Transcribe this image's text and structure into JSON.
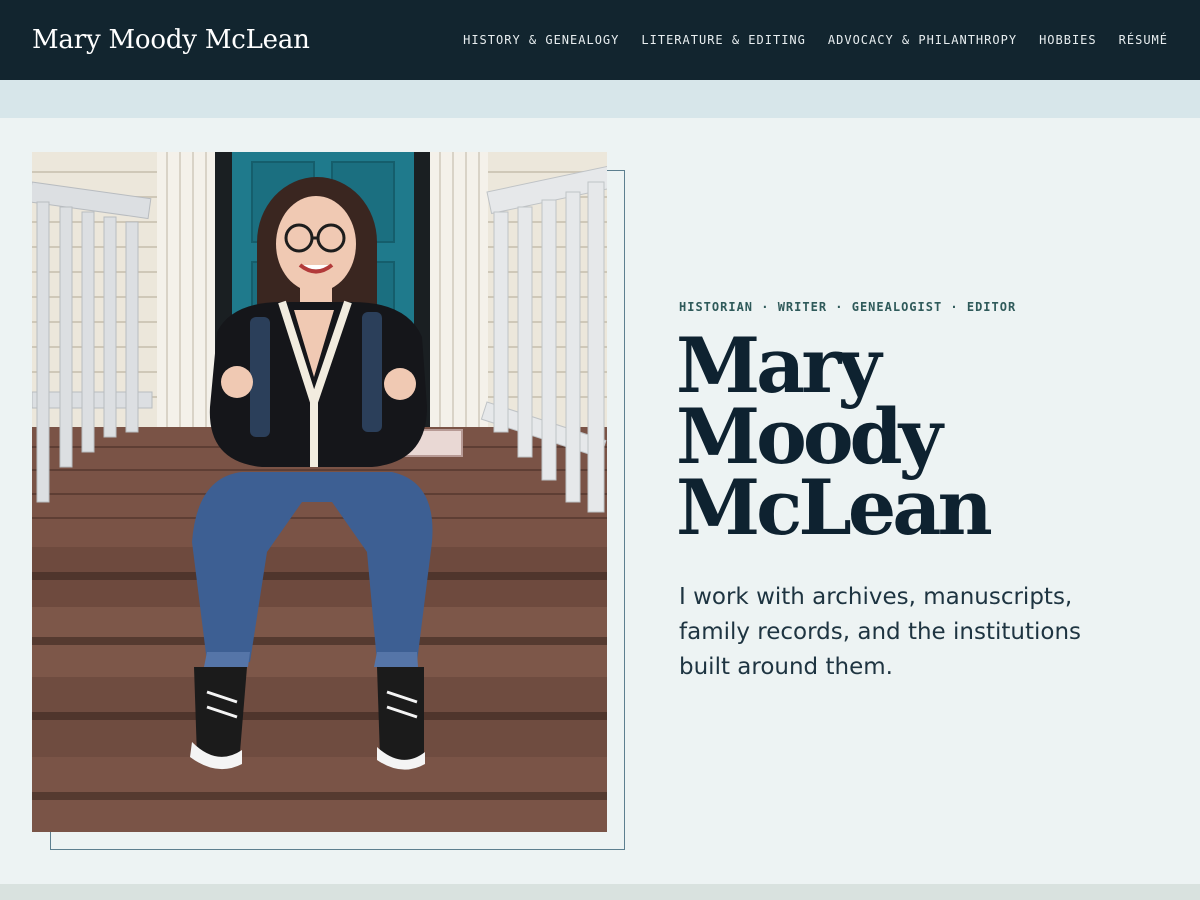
{
  "header": {
    "brand": "Mary Moody McLean",
    "nav": [
      {
        "label": "HISTORY & GENEALOGY"
      },
      {
        "label": "LITERATURE & EDITING"
      },
      {
        "label": "ADVOCACY & PHILANTHROPY"
      },
      {
        "label": "HOBBIES"
      },
      {
        "label": "RÉSUMÉ"
      }
    ]
  },
  "hero": {
    "tagline": "HISTORIAN · WRITER · GENEALOGIST · EDITOR",
    "name_lines": [
      "Mary",
      "Moody",
      "McLean"
    ],
    "intro": "I work with archives, manuscripts, family records, and the institutions built around them."
  },
  "colors": {
    "header_bg": "#12252f",
    "page_bg": "#edf3f3",
    "band_bg": "#d7e6ea",
    "frame_border": "#5d7f8f",
    "heading": "#0e2230"
  },
  "photo": {
    "subject": "person-sitting-on-porch-steps"
  }
}
